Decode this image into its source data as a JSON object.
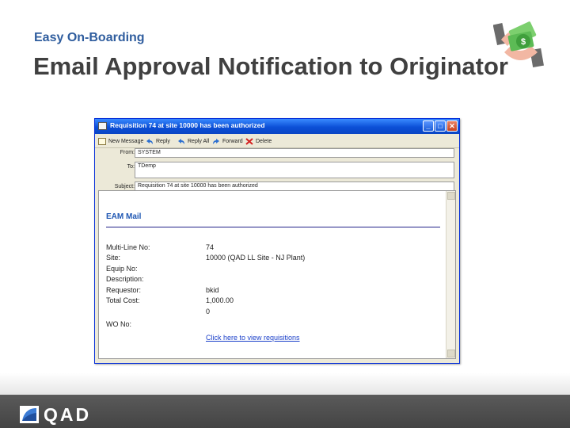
{
  "slide": {
    "subtitle": "Easy On-Boarding",
    "title": "Email Approval Notification to Originator",
    "footer_logo_text": "QAD"
  },
  "window": {
    "title": "Requisition 74 at site 10000 has been authorized",
    "buttons": {
      "minimize": "_",
      "maximize": "□",
      "close": "✕"
    }
  },
  "toolbar": {
    "items": [
      {
        "label": "New Message",
        "icon": "new-message-icon"
      },
      {
        "label": "Reply",
        "icon": "reply-icon"
      },
      {
        "label": "Reply All",
        "icon": "reply-all-icon"
      },
      {
        "label": "Forward",
        "icon": "forward-icon"
      },
      {
        "label": "Delete",
        "icon": "delete-icon"
      }
    ]
  },
  "headers": {
    "from_label": "From:",
    "from_value": "SYSTEM",
    "to_label": "To:",
    "to_value": "TDemp",
    "subject_label": "Subject:",
    "subject_value": "Requisition 74 at site 10000 has been authorized"
  },
  "message": {
    "heading": "EAM Mail",
    "rows": [
      {
        "label": "Multi-Line No:",
        "value": "74"
      },
      {
        "label": "Site:",
        "value": "10000 (QAD LL Site - NJ Plant)"
      },
      {
        "label": "Equip No:",
        "value": ""
      },
      {
        "label": "Description:",
        "value": ""
      },
      {
        "label": "Requestor:",
        "value": "bkid"
      },
      {
        "label": "Total Cost:",
        "value": "1,000.00"
      },
      {
        "label": "",
        "value": "0"
      },
      {
        "label": "WO No:",
        "value": ""
      }
    ],
    "link_text": "Click here to view requisitions"
  },
  "colors": {
    "accent": "#2f5d9e",
    "title_text": "#404040",
    "titlebar": "#0b4fd6",
    "link": "#1a3fc9",
    "footer": "#4a4a4a"
  }
}
